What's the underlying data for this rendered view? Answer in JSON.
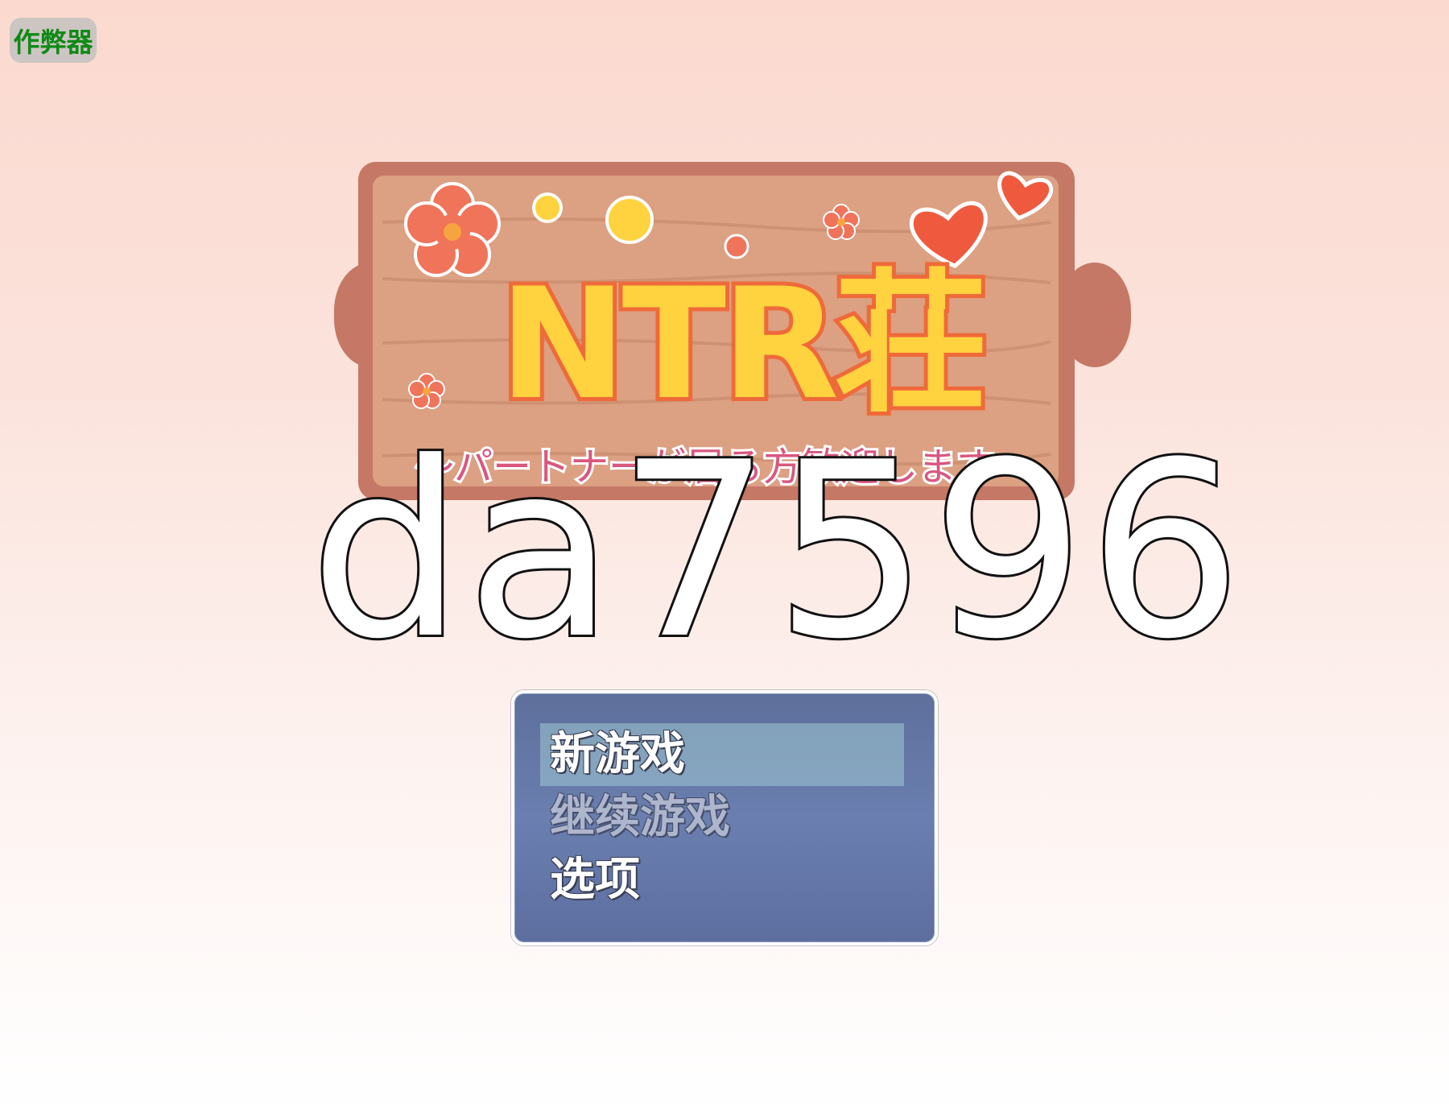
{
  "cheat_button": {
    "label": "作弊器"
  },
  "title": {
    "main": "NTR荘",
    "subtitle": "～パートナーが居る方歓迎します～",
    "sign_decorations": [
      "flower-icon",
      "heart-icon",
      "dot-icon"
    ]
  },
  "watermark": {
    "text": "da7596"
  },
  "menu": {
    "items": [
      {
        "label": "新游戏",
        "state": "selected"
      },
      {
        "label": "继续游戏",
        "state": "disabled"
      },
      {
        "label": "选项",
        "state": "normal"
      }
    ]
  },
  "colors": {
    "cheat_text": "#0f8a16",
    "title_fill": "#ffd23f",
    "title_outline": "#ef6a3a",
    "subtitle": "#d9577f",
    "menu_bg": "#6a7fb0",
    "wood": "#d9997a"
  }
}
